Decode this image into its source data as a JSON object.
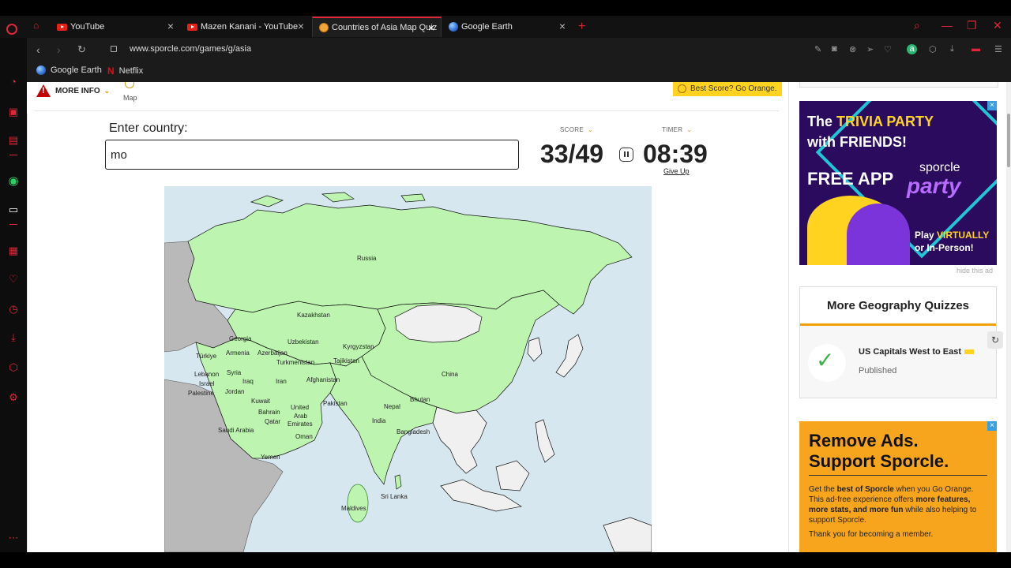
{
  "browser": {
    "tabs": [
      {
        "label": "YouTube",
        "icon": "youtube-icon"
      },
      {
        "label": "Mazen Kanani - YouTube",
        "icon": "youtube-icon"
      },
      {
        "label": "Countries of Asia Map Quiz",
        "icon": "sporcle-icon",
        "active": true
      },
      {
        "label": "Google Earth",
        "icon": "globe-icon"
      }
    ],
    "url": "www.sporcle.com/games/g/asia",
    "bookmarks": [
      {
        "label": "Google Earth"
      },
      {
        "label": "Netflix"
      }
    ],
    "accent_color": "#e0263a"
  },
  "quiz": {
    "more_info": "MORE INFO",
    "map_label": "Map",
    "best_score": "Best Score? Go Orange.",
    "enter_label": "Enter country:",
    "answer_value": "mo",
    "score_label": "SCORE",
    "score_value": "33/49",
    "timer_label": "TIMER",
    "timer_value": "08:39",
    "give_up": "Give Up"
  },
  "map_labels": {
    "russia": "Russia",
    "kazakhstan": "Kazakhstan",
    "uzbekistan": "Uzbekistan",
    "kyrgyzstan": "Kyrgyzstan",
    "georgia": "Georgia",
    "azerbaijan": "Azerbaijan",
    "turkiye": "Türkiye",
    "armenia": "Armenia",
    "turkmenistan": "Turkmenistan",
    "tajikistan": "Tajikistan",
    "lebanon": "Lebanon",
    "syria": "Syria",
    "israel": "Israel",
    "iraq": "Iraq",
    "iran": "Iran",
    "afghanistan": "Afghanistan",
    "palestine": "Palestine",
    "jordan": "Jordan",
    "china": "China",
    "kuwait": "Kuwait",
    "bahrain": "Bahrain",
    "qatar": "Qatar",
    "united": "United",
    "arab": "Arab",
    "emirates": "Emirates",
    "pakistan": "Pakistan",
    "nepal": "Nepal",
    "bhutan": "Bhutan",
    "india": "India",
    "bangladesh": "Bangladesh",
    "saudi_arabia": "Saudi Arabia",
    "oman": "Oman",
    "yemen": "Yemen",
    "sri_lanka": "Sri Lanka",
    "maldives": "Maldives"
  },
  "map_colors": {
    "found": "#bdf5b0",
    "unfound": "#f0f0f0",
    "ocean": "#d7e7ef",
    "outside": "#b9b9b9"
  },
  "ads": {
    "trivia_line1": "The ",
    "trivia_line1_highlight": "TRIVIA PARTY",
    "trivia_line2": "with FRIENDS!",
    "trivia_free": "FREE APP",
    "trivia_brand": "sporcle",
    "trivia_party": "party",
    "trivia_play": "Play ",
    "trivia_virtually": "VIRTUALLY",
    "trivia_or": "or In-Person!",
    "hide_ad": "hide this ad",
    "remove_title": "Remove Ads. Support Sporcle.",
    "remove_p1_a": "Get the ",
    "remove_p1_b": "best of Sporcle",
    "remove_p1_c": " when you Go Orange. This ad-free experience offers ",
    "remove_p1_d": "more features, more stats, and more fun",
    "remove_p1_e": " while also helping to support Sporcle.",
    "remove_p2": "Thank you for becoming a member."
  },
  "sidebar_quizzes": {
    "heading": "More Geography Quizzes",
    "items": [
      {
        "title": "US Capitals West to East",
        "status": "Published"
      }
    ]
  }
}
